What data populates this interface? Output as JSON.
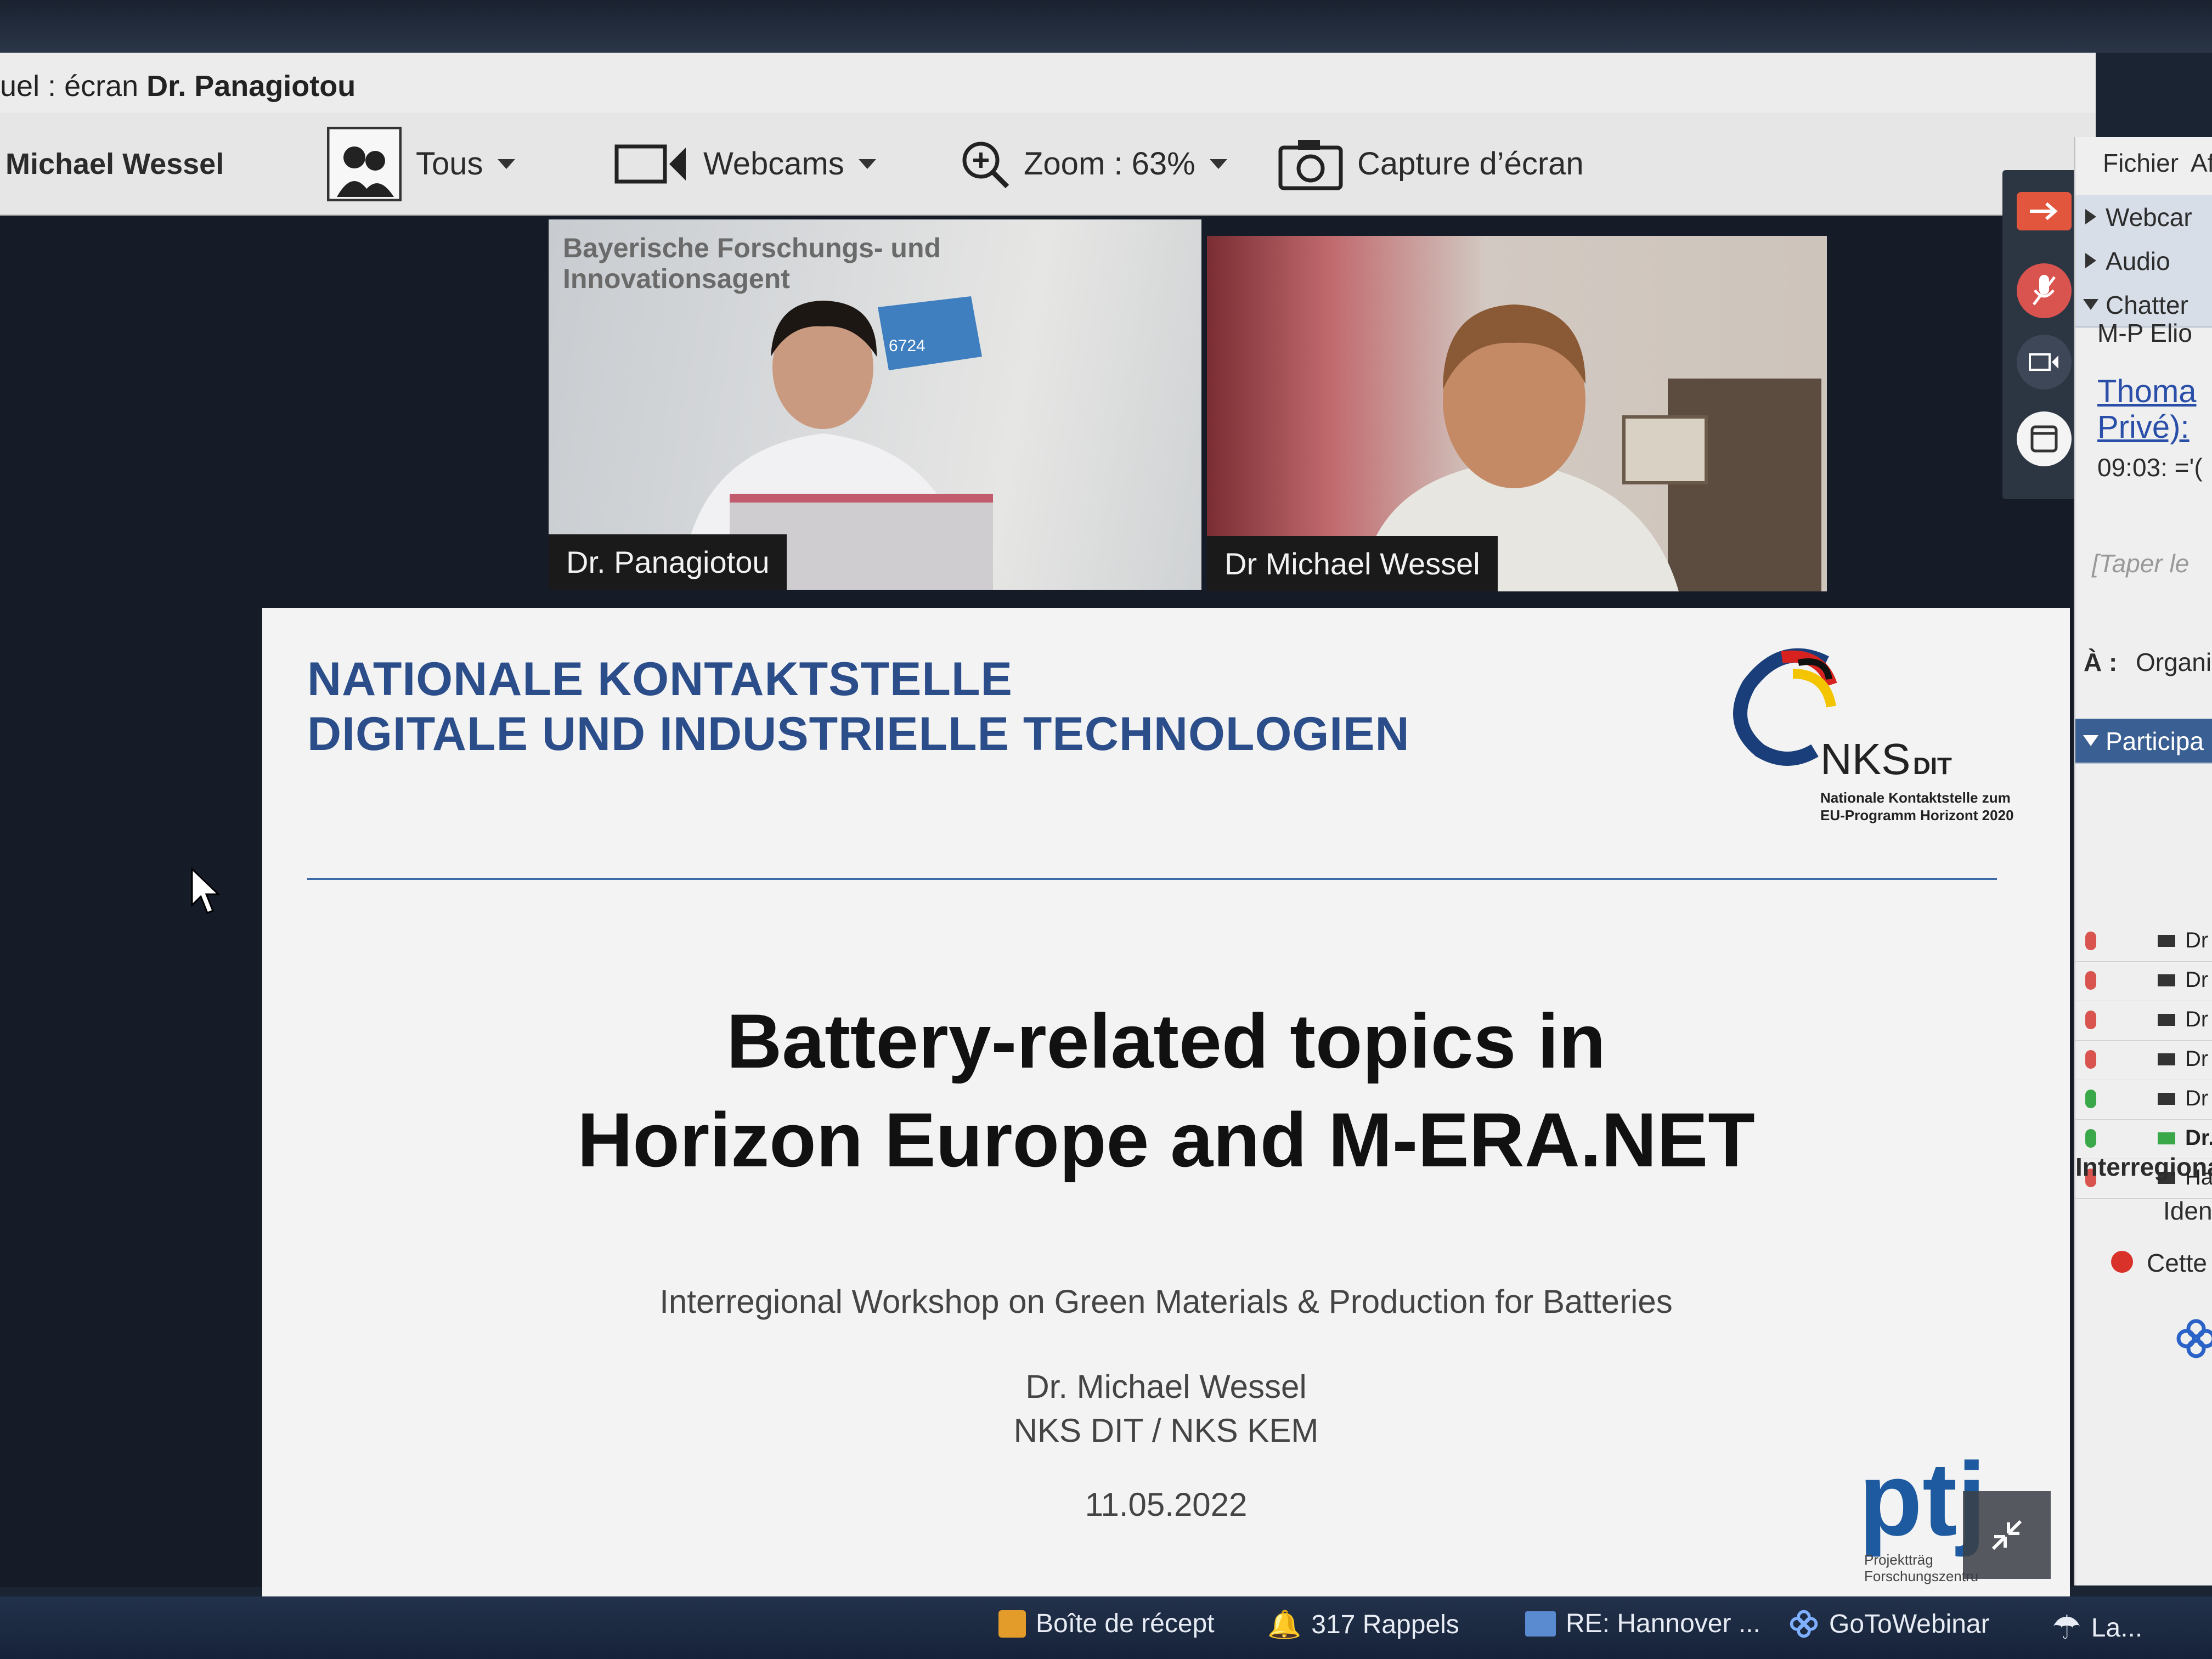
{
  "window": {
    "title_prefix": "uel : écran",
    "title_name": "Dr. Panagiotou"
  },
  "toolbar": {
    "presenter": "Michael Wessel",
    "audience_label": "Tous",
    "webcams_label": "Webcams",
    "zoom_label": "Zoom : 63%",
    "capture_label": "Capture d’écran"
  },
  "videos": [
    {
      "name": "Dr. Panagiotou",
      "poster_text": "Bayerische Forschungs- und Innovationsagent",
      "badge": "6724"
    },
    {
      "name": "Dr Michael Wessel"
    }
  ],
  "slide": {
    "header_line1": "NATIONALE KONTAKTSTELLE",
    "header_line2": "DIGITALE UND INDUSTRIELLE TECHNOLOGIEN",
    "logo_main": "NKS",
    "logo_suffix": "DIT",
    "logo_sub1": "Nationale Kontaktstelle zum",
    "logo_sub2": "EU-Programm Horizont 2020",
    "title_line1": "Battery-related topics in",
    "title_line2": "Horizon Europe and M-ERA.NET",
    "workshop": "Interregional Workshop on Green Materials & Production for Batteries",
    "speaker": "Dr. Michael Wessel",
    "affiliation": "NKS DIT / NKS KEM",
    "date": "11.05.2022",
    "ptj_logo": "ptj",
    "ptj_sub1": "Projektträg",
    "ptj_sub2": "Forschungszentru"
  },
  "panel": {
    "menu_file": "Fichier",
    "menu_af": "Af",
    "section_webcam": "Webcar",
    "section_audio": "Audio",
    "section_chat": "Chatter",
    "chat_line1": "M-P Elio",
    "chat_link1": "Thoma",
    "chat_link2": "Privé):",
    "chat_time": "09:03: ='(",
    "chat_placeholder": "[Taper le",
    "to_label": "À :",
    "to_value": "Organi",
    "section_participants": "Participa",
    "participants": [
      "Dr",
      "Dr",
      "Dr .",
      "Dr I",
      "Dr M",
      "Dr.",
      "Hale"
    ],
    "webinar_title": "Interregiona",
    "webinar_id": "Identi",
    "webinar_status": "Cette s"
  },
  "taskbar": {
    "item1": "Boîte de récept",
    "item2": "317 Rappels",
    "item3": "RE: Hannover ...",
    "item4": "GoToWebinar",
    "item5": "La..."
  },
  "colors": {
    "slide_header": "#2b4d8a",
    "mic_muted": "#d9534f",
    "mic_active": "#3aa848",
    "taskbar": "#1c2a40"
  }
}
